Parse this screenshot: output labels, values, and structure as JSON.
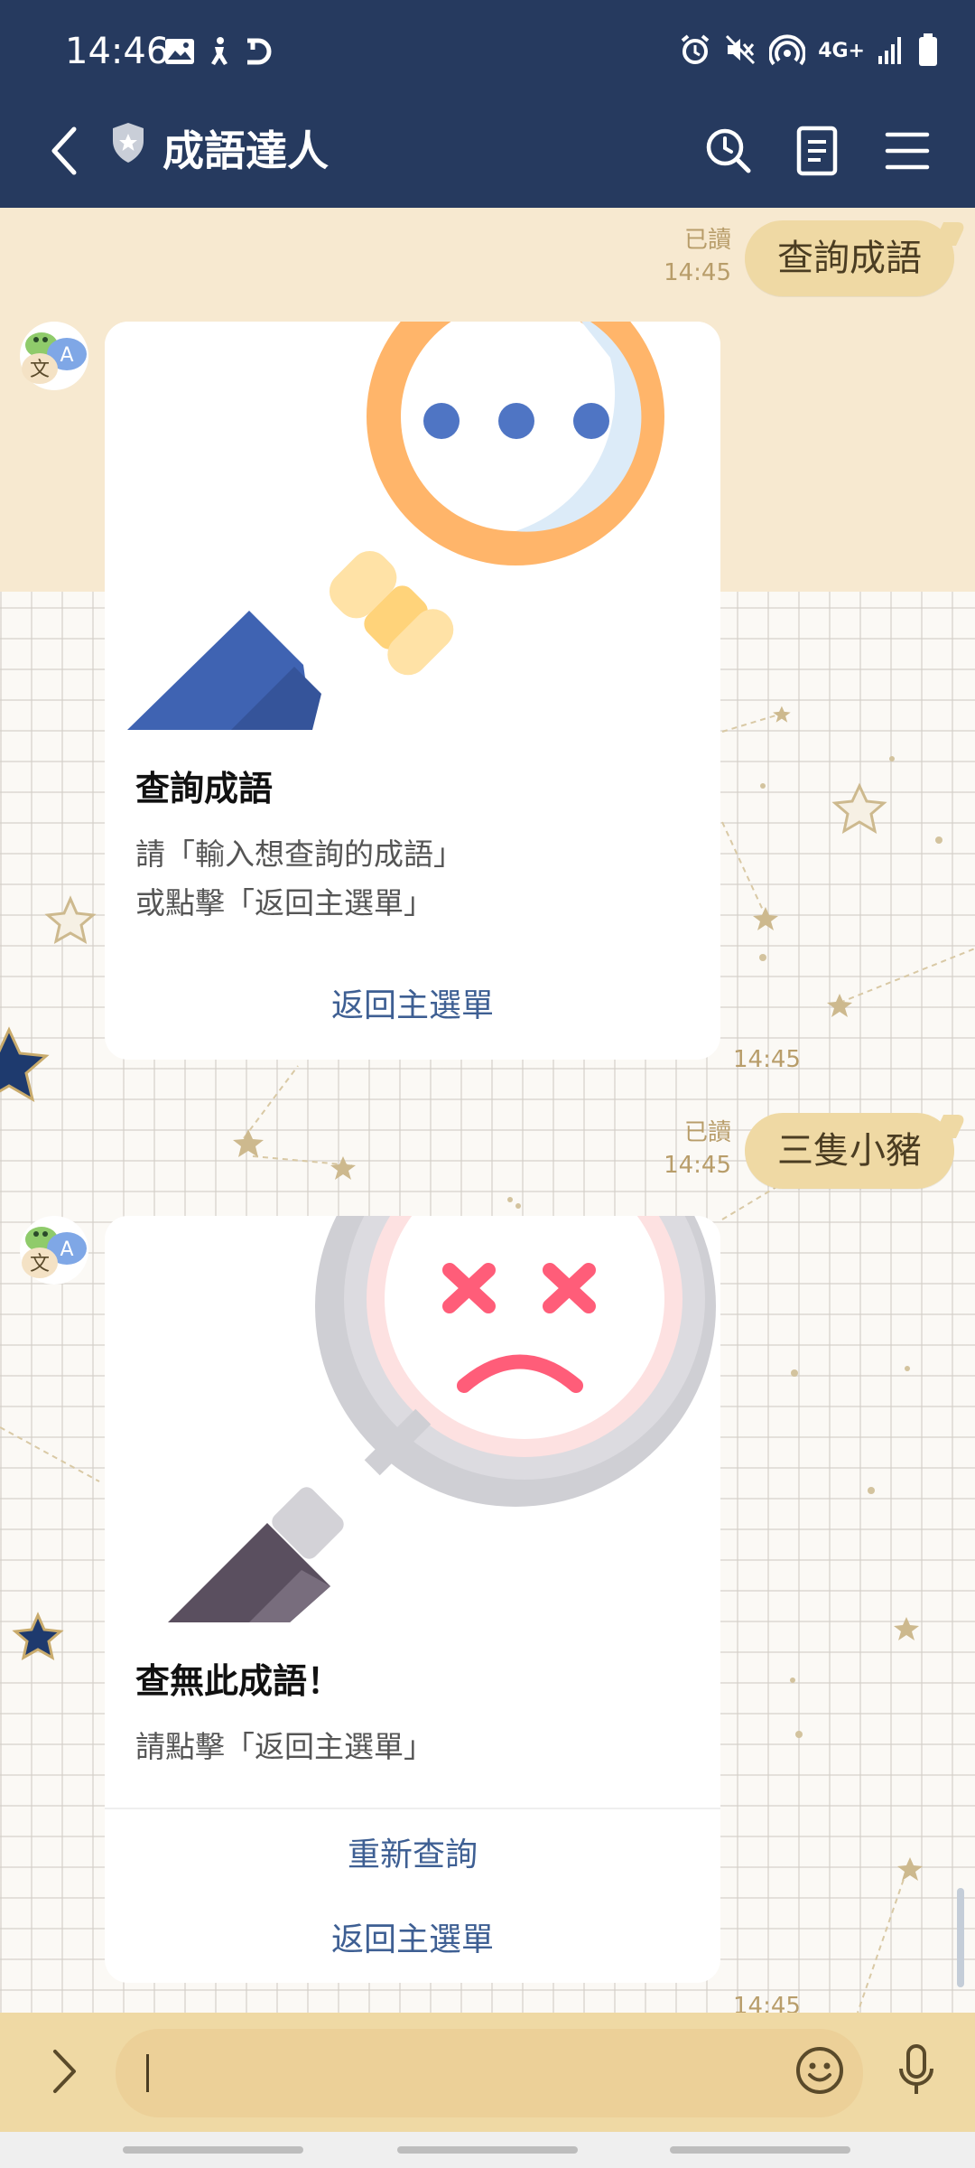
{
  "status_bar": {
    "time": "14:46",
    "network": "4G+",
    "icons": [
      "image-icon",
      "accessibility-icon",
      "d-icon",
      "alarm-icon",
      "mute-icon",
      "hotspot-icon",
      "signal-icon",
      "battery-icon"
    ]
  },
  "header": {
    "title": "成語達人",
    "icons": [
      "back-arrow-icon",
      "shield-icon",
      "search-history-icon",
      "notes-icon",
      "menu-icon"
    ]
  },
  "messages": [
    {
      "type": "user",
      "read_label": "已讀",
      "time": "14:45",
      "text": "查詢成語"
    },
    {
      "type": "bot_card",
      "title": "查詢成語",
      "desc_lines": [
        "請「輸入想查詢的成語」",
        "或點擊「返回主選單」"
      ],
      "actions": [
        "返回主選單"
      ],
      "time": "14:45"
    },
    {
      "type": "user",
      "read_label": "已讀",
      "time": "14:45",
      "text": "三隻小豬"
    },
    {
      "type": "bot_card",
      "title": "查無此成語！",
      "desc_lines": [
        "請點擊「返回主選單」"
      ],
      "actions": [
        "重新查詢",
        "返回主選單"
      ],
      "time": "14:45"
    }
  ],
  "input": {
    "value": "",
    "icons": [
      "chevron-right-icon",
      "emoji-icon",
      "microphone-icon"
    ]
  },
  "colors": {
    "header_bg": "#263a5f",
    "bubble_user": "#efd9a4",
    "link": "#3e5f93",
    "band": "#f7e9d0"
  }
}
